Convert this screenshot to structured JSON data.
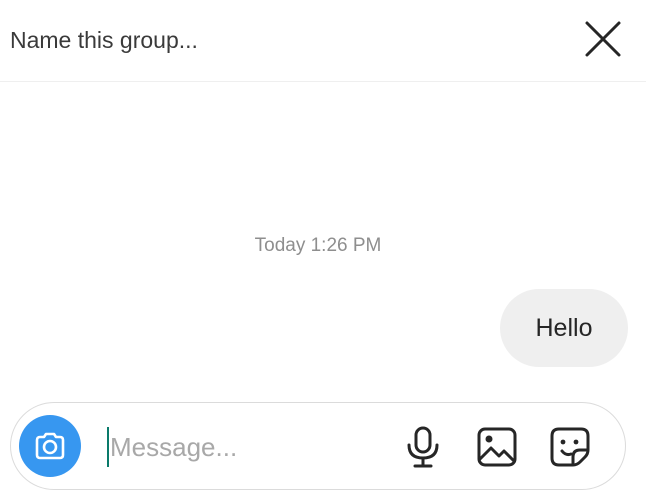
{
  "header": {
    "group_name_placeholder": "Name this group...",
    "close_icon": "close-icon"
  },
  "chat": {
    "timestamp": "Today 1:26 PM",
    "messages": [
      {
        "text": "Hello",
        "direction": "outgoing"
      }
    ]
  },
  "composer": {
    "camera_icon": "camera-icon",
    "message_placeholder": "Message...",
    "message_value": "",
    "tools": [
      {
        "icon": "microphone-icon"
      },
      {
        "icon": "gallery-icon"
      },
      {
        "icon": "sticker-icon"
      }
    ]
  },
  "colors": {
    "camera_button": "#3797f0",
    "bubble_background": "#efefef",
    "timestamp_text": "#8e8e8e",
    "cursor": "#0a7a6a"
  }
}
